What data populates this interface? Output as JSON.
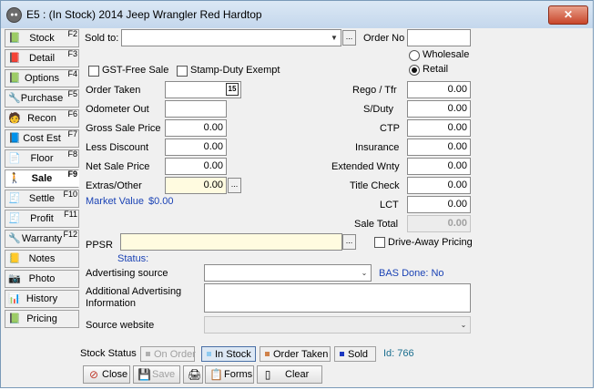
{
  "window": {
    "title": "E5 : (In Stock) 2014 Jeep Wrangler  Red Hardtop",
    "close_glyph": "✕"
  },
  "sidebar": [
    {
      "label": "Stock",
      "key": "F2",
      "icon": "📗"
    },
    {
      "label": "Detail",
      "key": "F3",
      "icon": "📕"
    },
    {
      "label": "Options",
      "key": "F4",
      "icon": "📗"
    },
    {
      "label": "Purchase",
      "key": "F5",
      "icon": "🔧"
    },
    {
      "label": "Recon",
      "key": "F6",
      "icon": "🧑"
    },
    {
      "label": "Cost Est",
      "key": "F7",
      "icon": "📘"
    },
    {
      "label": "Floor",
      "key": "F8",
      "icon": "📄"
    },
    {
      "label": "Sale",
      "key": "F9",
      "icon": "🚶"
    },
    {
      "label": "Settle",
      "key": "F10",
      "icon": "🧾"
    },
    {
      "label": "Profit",
      "key": "F11",
      "icon": "🧾"
    },
    {
      "label": "Warranty",
      "key": "F12",
      "icon": "🔧"
    },
    {
      "label": "Notes",
      "key": "",
      "icon": "📒"
    },
    {
      "label": "Photo",
      "key": "",
      "icon": "📷"
    },
    {
      "label": "History",
      "key": "",
      "icon": "📊"
    },
    {
      "label": "Pricing",
      "key": "",
      "icon": "📗"
    }
  ],
  "sale": {
    "sold_to_label": "Sold to:",
    "sold_to_value": "",
    "order_no_label": "Order No",
    "order_no_value": "",
    "gst_free_label": "GST-Free Sale",
    "stamp_duty_label": "Stamp-Duty Exempt",
    "wholesale_label": "Wholesale",
    "retail_label": "Retail",
    "order_taken_label": "Order Taken",
    "odometer_label": "Odometer Out",
    "gross_label": "Gross Sale Price",
    "gross_value": "0.00",
    "less_discount_label": "Less Discount",
    "less_discount_value": "0.00",
    "net_label": "Net Sale Price",
    "net_value": "0.00",
    "extras_label": "Extras/Other",
    "extras_value": "0.00",
    "market_value_label": "Market Value",
    "market_value": "$0.00",
    "rego_label": "Rego / Tfr",
    "rego_value": "0.00",
    "sduty_label": "S/Duty",
    "sduty_value": "0.00",
    "ctp_label": "CTP",
    "ctp_value": "0.00",
    "insurance_label": "Insurance",
    "insurance_value": "0.00",
    "ext_wnty_label": "Extended Wnty",
    "ext_wnty_value": "0.00",
    "title_check_label": "Title Check",
    "title_check_value": "0.00",
    "lct_label": "LCT",
    "lct_value": "0.00",
    "sale_total_label": "Sale Total",
    "sale_total_value": "0.00",
    "ppsr_label": "PPSR",
    "status_label": "Status:",
    "drive_away_label": "Drive-Away Pricing",
    "adv_source_label": "Advertising source",
    "bas_done_label": "BAS Done: No",
    "additional_adv_label": "Additional Advertising Information",
    "source_website_label": "Source website",
    "dots": "...",
    "calendar_glyph": "15"
  },
  "stock_status": {
    "label": "Stock Status",
    "buttons": [
      {
        "label": "On Order",
        "color": "#b0b0b0"
      },
      {
        "label": "In Stock",
        "color": "#8ecaf0"
      },
      {
        "label": "Order Taken",
        "color": "#d0824a"
      },
      {
        "label": "Sold",
        "color": "#1a36c0"
      }
    ],
    "id_text": "Id: 766"
  },
  "actions": [
    {
      "label": "Close",
      "icon": "⊘"
    },
    {
      "label": "Save",
      "icon": "💾"
    },
    {
      "label": "",
      "icon": "🖨"
    },
    {
      "label": "Forms",
      "icon": "📋"
    },
    {
      "label": "Clear",
      "icon": "▯"
    }
  ]
}
